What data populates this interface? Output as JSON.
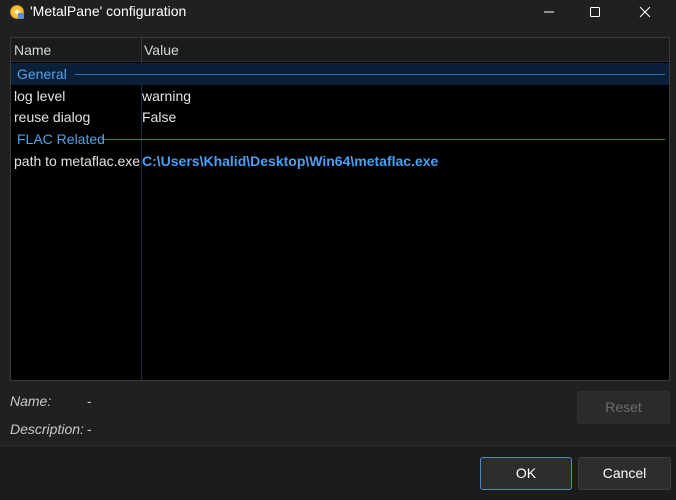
{
  "window": {
    "title": "'MetalPane' configuration",
    "app_icon": "gear-icon"
  },
  "grid": {
    "headers": {
      "name": "Name",
      "value": "Value"
    },
    "groups": [
      {
        "label": "General",
        "selected": true,
        "properties": [
          {
            "name": "log level",
            "value": "warning"
          },
          {
            "name": "reuse dialog",
            "value": "False"
          }
        ]
      },
      {
        "label": "FLAC Related",
        "selected": false,
        "properties": [
          {
            "name": "path to metaflac.exe",
            "value": "C:\\Users\\Khalid\\Desktop\\Win64\\metaflac.exe"
          }
        ]
      }
    ]
  },
  "info": {
    "name_label": "Name:",
    "name_value": "-",
    "description_label": "Description:",
    "description_value": "-"
  },
  "buttons": {
    "reset": "Reset",
    "ok": "OK",
    "cancel": "Cancel"
  },
  "colors": {
    "accent": "#4a9ff5",
    "group_line": "#2b6fb5",
    "selection": "#0a2038"
  }
}
